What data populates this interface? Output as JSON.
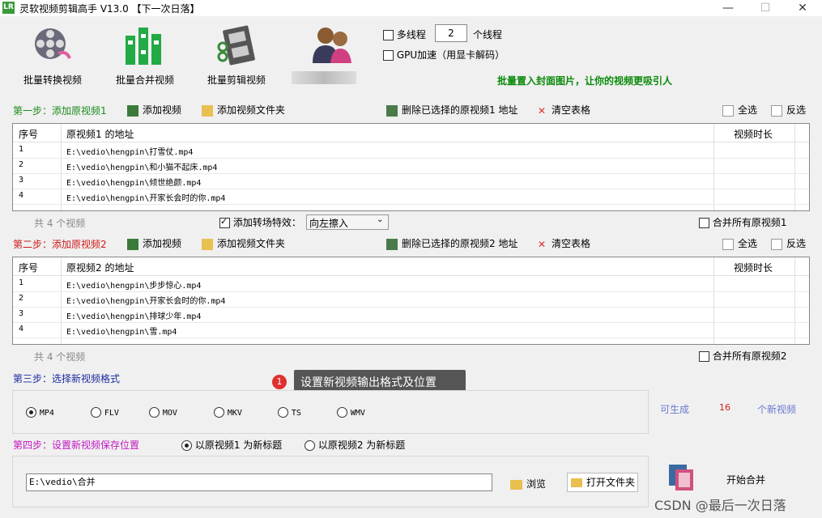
{
  "window": {
    "title": "灵软视频剪辑高手 V13.0 【下一次日落】",
    "app_icon": "LR",
    "minimize": "—",
    "maximize": "☐",
    "close": "✕"
  },
  "toolbar": {
    "batch_convert": "批量转换视频",
    "batch_merge": "批量合并视频",
    "batch_clip": "批量剪辑视频",
    "multithread_label": "多线程",
    "thread_count": "2",
    "thread_unit": "个线程",
    "gpu_label": "GPU加速（用显卡解码）",
    "promo": "批量置入封面图片，让你的视频更吸引人"
  },
  "step1": {
    "label": "第一步：添加原视频1",
    "add_video": "添加视频",
    "add_folder": "添加视频文件夹",
    "delete_selected": "删除已选择的原视频1 地址",
    "clear_table": "清空表格",
    "select_all": "全选",
    "invert": "反选",
    "columns": [
      "序号",
      "原视频1 的地址",
      "视频时长"
    ],
    "rows": [
      {
        "idx": "1",
        "path": "E:\\vedio\\hengpin\\打雪仗.mp4",
        "duration": ""
      },
      {
        "idx": "2",
        "path": "E:\\vedio\\hengpin\\和小猫不起床.mp4",
        "duration": ""
      },
      {
        "idx": "3",
        "path": "E:\\vedio\\hengpin\\倾世绝颜.mp4",
        "duration": ""
      },
      {
        "idx": "4",
        "path": "E:\\vedio\\hengpin\\开家长会时的你.mp4",
        "duration": ""
      }
    ],
    "count": "共 4 个视频",
    "transition_label": "添加转场特效：",
    "transition_value": "向左擦入",
    "merge_all": "合并所有原视频1"
  },
  "step2": {
    "label": "第二步：添加原视频2",
    "add_video": "添加视频",
    "add_folder": "添加视频文件夹",
    "delete_selected": "删除已选择的原视频2 地址",
    "clear_table": "清空表格",
    "select_all": "全选",
    "invert": "反选",
    "columns": [
      "序号",
      "原视频2 的地址",
      "视频时长"
    ],
    "rows": [
      {
        "idx": "1",
        "path": "E:\\vedio\\hengpin\\步步惊心.mp4",
        "duration": ""
      },
      {
        "idx": "2",
        "path": "E:\\vedio\\hengpin\\开家长会时的你.mp4",
        "duration": ""
      },
      {
        "idx": "3",
        "path": "E:\\vedio\\hengpin\\排球少年.mp4",
        "duration": ""
      },
      {
        "idx": "4",
        "path": "E:\\vedio\\hengpin\\雪.mp4",
        "duration": ""
      }
    ],
    "count": "共 4 个视频",
    "merge_all": "合并所有原视频2"
  },
  "step3": {
    "label": "第三步：选择新视频格式",
    "tooltip_badge": "1",
    "tooltip": "设置新视频输出格式及位置",
    "formats": [
      "MP4",
      "FLV",
      "MOV",
      "MKV",
      "TS",
      "WMV"
    ],
    "selected_format": "MP4",
    "can_generate": "可生成",
    "generate_count": "16",
    "new_videos": "个新视频"
  },
  "step4": {
    "label": "第四步：设置新视频保存位置",
    "title_opt1": "以原视频1 为新标题",
    "title_opt2": "以原视频2 为新标题",
    "save_path": "E:\\vedio\\合并",
    "browse": "浏览",
    "open_folder": "打开文件夹",
    "start_merge": "开始合并"
  },
  "watermark": "CSDN @最后一次日落"
}
